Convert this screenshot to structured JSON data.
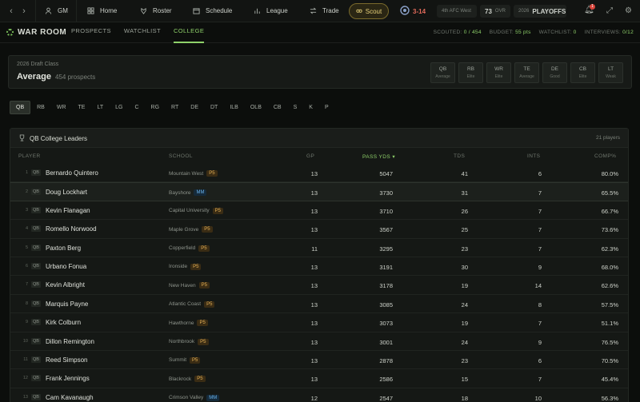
{
  "nav": {
    "gm": "GM",
    "home": "Home",
    "roster": "Roster",
    "schedule": "Schedule",
    "league": "League",
    "trade": "Trade",
    "scout": "Scout",
    "record": "3-14",
    "standing": "4th AFC West",
    "ovr_value": "73",
    "ovr_label": "OVR",
    "season_year": "2026",
    "season_phase": "PLAYOFFS",
    "notifications": "1"
  },
  "warroom": {
    "title": "WAR ROOM",
    "tabs": [
      "PROSPECTS",
      "WATCHLIST",
      "COLLEGE"
    ],
    "scouted_label": "SCOUTED:",
    "scouted_value": "0 / 454",
    "budget_label": "BUDGET:",
    "budget_value": "55 pts",
    "watchlist_label": "WATCHLIST:",
    "watchlist_value": "0",
    "interviews_label": "INTERVIEWS:",
    "interviews_value": "0/12"
  },
  "draft": {
    "subtitle": "2026 Draft Class",
    "grade": "Average",
    "count": "454 prospects",
    "position_grades": [
      {
        "pos": "QB",
        "grade": "Average"
      },
      {
        "pos": "RB",
        "grade": "Elite"
      },
      {
        "pos": "WR",
        "grade": "Elite"
      },
      {
        "pos": "TE",
        "grade": "Average"
      },
      {
        "pos": "DE",
        "grade": "Good"
      },
      {
        "pos": "CB",
        "grade": "Elite"
      },
      {
        "pos": "LT",
        "grade": "Weak"
      }
    ]
  },
  "positions": [
    "QB",
    "RB",
    "WR",
    "TE",
    "LT",
    "LG",
    "C",
    "RG",
    "RT",
    "DE",
    "DT",
    "ILB",
    "OLB",
    "CB",
    "S",
    "K",
    "P"
  ],
  "leaders": {
    "title": "QB College Leaders",
    "count": "21 players",
    "columns": {
      "player": "PLAYER",
      "school": "SCHOOL",
      "gp": "GP",
      "pass_yds": "PASS YDS ▾",
      "tds": "TDS",
      "ints": "INTS",
      "comp": "COMP%"
    },
    "rows": [
      {
        "rank": "1",
        "pos": "QB",
        "name": "Bernardo Quintero",
        "school": "Mountain West",
        "conf": "P5",
        "gp": "13",
        "yds": "5047",
        "tds": "41",
        "ints": "6",
        "comp": "80.0%"
      },
      {
        "rank": "2",
        "pos": "QB",
        "name": "Doug Lockhart",
        "school": "Bayshore",
        "conf": "MM",
        "gp": "13",
        "yds": "3730",
        "tds": "31",
        "ints": "7",
        "comp": "65.5%"
      },
      {
        "rank": "3",
        "pos": "QB",
        "name": "Kevin Flanagan",
        "school": "Capital University",
        "conf": "P5",
        "gp": "13",
        "yds": "3710",
        "tds": "26",
        "ints": "7",
        "comp": "66.7%"
      },
      {
        "rank": "4",
        "pos": "QB",
        "name": "Romello Norwood",
        "school": "Maple Grove",
        "conf": "P5",
        "gp": "13",
        "yds": "3567",
        "tds": "25",
        "ints": "7",
        "comp": "73.6%"
      },
      {
        "rank": "5",
        "pos": "QB",
        "name": "Paxton Berg",
        "school": "Copperfield",
        "conf": "P5",
        "gp": "11",
        "yds": "3295",
        "tds": "23",
        "ints": "7",
        "comp": "62.3%"
      },
      {
        "rank": "6",
        "pos": "QB",
        "name": "Urbano Fonua",
        "school": "Ironside",
        "conf": "P5",
        "gp": "13",
        "yds": "3191",
        "tds": "30",
        "ints": "9",
        "comp": "68.0%"
      },
      {
        "rank": "7",
        "pos": "QB",
        "name": "Kevin Albright",
        "school": "New Haven",
        "conf": "P5",
        "gp": "13",
        "yds": "3178",
        "tds": "19",
        "ints": "14",
        "comp": "62.6%"
      },
      {
        "rank": "8",
        "pos": "QB",
        "name": "Marquis Payne",
        "school": "Atlantic Coast",
        "conf": "P5",
        "gp": "13",
        "yds": "3085",
        "tds": "24",
        "ints": "8",
        "comp": "57.5%"
      },
      {
        "rank": "9",
        "pos": "QB",
        "name": "Kirk Colburn",
        "school": "Hawthorne",
        "conf": "P5",
        "gp": "13",
        "yds": "3073",
        "tds": "19",
        "ints": "7",
        "comp": "51.1%"
      },
      {
        "rank": "10",
        "pos": "QB",
        "name": "Dillon Remington",
        "school": "Northbrook",
        "conf": "P5",
        "gp": "13",
        "yds": "3001",
        "tds": "24",
        "ints": "9",
        "comp": "76.5%"
      },
      {
        "rank": "11",
        "pos": "QB",
        "name": "Reed Simpson",
        "school": "Summit",
        "conf": "P5",
        "gp": "13",
        "yds": "2878",
        "tds": "23",
        "ints": "6",
        "comp": "70.5%"
      },
      {
        "rank": "12",
        "pos": "QB",
        "name": "Frank Jennings",
        "school": "Blackrock",
        "conf": "P5",
        "gp": "13",
        "yds": "2586",
        "tds": "15",
        "ints": "7",
        "comp": "45.4%"
      },
      {
        "rank": "13",
        "pos": "QB",
        "name": "Cam Kavanaugh",
        "school": "Crimson Valley",
        "conf": "MM",
        "gp": "12",
        "yds": "2547",
        "tds": "18",
        "ints": "10",
        "comp": "56.3%"
      }
    ]
  },
  "colors": {
    "accent": "#8fd16a",
    "p5": "#e1ae55",
    "mm": "#68b0e8",
    "loss": "#e06a5a",
    "scout": "#e8d27a"
  }
}
